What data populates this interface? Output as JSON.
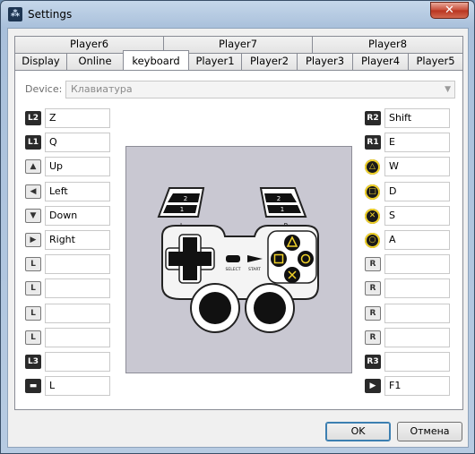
{
  "window": {
    "title": "Settings",
    "close_glyph": "✕"
  },
  "tabs": {
    "row1": [
      "Player6",
      "Player7",
      "Player8"
    ],
    "row2": [
      "Display",
      "Online",
      "keyboard",
      "Player1",
      "Player2",
      "Player3",
      "Player4",
      "Player5"
    ],
    "active": "keyboard"
  },
  "device": {
    "label": "Device:",
    "value": "Клавиатура"
  },
  "left_bindings": [
    {
      "icon": "l2-icon",
      "glyph": "L2",
      "value": "Z"
    },
    {
      "icon": "l1-icon",
      "glyph": "L1",
      "value": "Q"
    },
    {
      "icon": "dpad-up-icon",
      "glyph": "▲",
      "value": "Up"
    },
    {
      "icon": "dpad-left-icon",
      "glyph": "◀",
      "value": "Left"
    },
    {
      "icon": "dpad-down-icon",
      "glyph": "▼",
      "value": "Down"
    },
    {
      "icon": "dpad-right-icon",
      "glyph": "▶",
      "value": "Right"
    },
    {
      "icon": "left-stick-up-icon",
      "glyph": "L",
      "value": ""
    },
    {
      "icon": "left-stick-left-icon",
      "glyph": "L",
      "value": ""
    },
    {
      "icon": "left-stick-down-icon",
      "glyph": "L",
      "value": ""
    },
    {
      "icon": "left-stick-right-icon",
      "glyph": "L",
      "value": ""
    },
    {
      "icon": "l3-icon",
      "glyph": "L3",
      "value": ""
    },
    {
      "icon": "select-icon",
      "glyph": "▬",
      "value": "L"
    }
  ],
  "right_bindings": [
    {
      "icon": "r2-icon",
      "glyph": "R2",
      "value": "Shift"
    },
    {
      "icon": "r1-icon",
      "glyph": "R1",
      "value": "E"
    },
    {
      "icon": "triangle-icon",
      "glyph": "△",
      "value": "W"
    },
    {
      "icon": "square-icon",
      "glyph": "□",
      "value": "D"
    },
    {
      "icon": "cross-icon",
      "glyph": "✕",
      "value": "S"
    },
    {
      "icon": "circle-icon",
      "glyph": "○",
      "value": "A"
    },
    {
      "icon": "right-stick-up-icon",
      "glyph": "R",
      "value": ""
    },
    {
      "icon": "right-stick-left-icon",
      "glyph": "R",
      "value": ""
    },
    {
      "icon": "right-stick-down-icon",
      "glyph": "R",
      "value": ""
    },
    {
      "icon": "right-stick-right-icon",
      "glyph": "R",
      "value": ""
    },
    {
      "icon": "r3-icon",
      "glyph": "R3",
      "value": ""
    },
    {
      "icon": "start-icon",
      "glyph": "▶",
      "value": "F1"
    }
  ],
  "gamepad": {
    "l_label": "L",
    "r_label": "R",
    "shoulder_top": "2",
    "shoulder_bottom": "1",
    "select_label": "SELECT",
    "start_label": "START"
  },
  "buttons": {
    "ok": "OK",
    "cancel": "Отмена"
  }
}
